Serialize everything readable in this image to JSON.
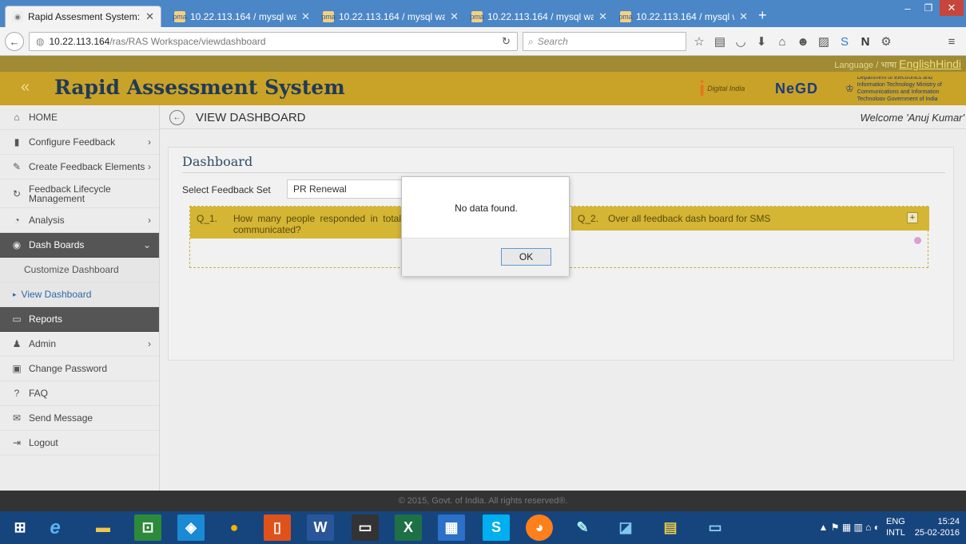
{
  "browser": {
    "tabs": [
      {
        "title": "Rapid Assesment System: ...",
        "active": true
      },
      {
        "title": "10.22.113.164 / mysql wa...",
        "active": false
      },
      {
        "title": "10.22.113.164 / mysql wa...",
        "active": false
      },
      {
        "title": "10.22.113.164 / mysql wa...",
        "active": false
      },
      {
        "title": "10.22.113.164 / mysql wa...",
        "active": false
      }
    ],
    "url_host": "10.22.113.164",
    "url_path": "/ras/RAS Workspace/viewdashboard",
    "search_placeholder": "Search"
  },
  "header": {
    "language_label": "Language / भाषा",
    "lang_english": "English",
    "lang_hindi": "Hindi",
    "app_title": "Rapid Assessment System",
    "logo_digital_india": "Digital India",
    "logo_negd": "NeGD",
    "logo_deity": "Department of Electronics and Information Technology Ministry of Communications and Information Technology Government of India"
  },
  "sidebar": {
    "items": [
      {
        "label": "HOME",
        "icon": "home-icon"
      },
      {
        "label": "Configure Feedback",
        "icon": "file-icon"
      },
      {
        "label": "Create Feedback Elements",
        "icon": "pencil-icon"
      },
      {
        "label": "Feedback Lifecycle Management",
        "icon": "refresh-icon"
      },
      {
        "label": "Analysis",
        "icon": "pie-icon"
      },
      {
        "label": "Dash Boards",
        "icon": "dashboard-icon"
      },
      {
        "label": "Customize Dashboard",
        "icon": ""
      },
      {
        "label": "View Dashboard",
        "icon": "caret-right-icon"
      },
      {
        "label": "Reports",
        "icon": "report-icon"
      },
      {
        "label": "Admin",
        "icon": "user-icon"
      },
      {
        "label": "Change Password",
        "icon": "lock-icon"
      },
      {
        "label": "FAQ",
        "icon": "question-icon"
      },
      {
        "label": "Send Message",
        "icon": "envelope-icon"
      },
      {
        "label": "Logout",
        "icon": "logout-icon"
      }
    ]
  },
  "main": {
    "page_title": "VIEW DASHBOARD",
    "welcome": "Welcome 'Anuj Kumar'",
    "dashboard_title": "Dashboard",
    "select_label": "Select Feedback Set",
    "select_value": "PR Renewal",
    "q1_num": "Q_1.",
    "q1_text": "How many people responded in total communicated?",
    "q2_num": "Q_2.",
    "q2_text": "Over all feedback dash board for SMS"
  },
  "dialog": {
    "message": "No data found.",
    "ok_label": "OK"
  },
  "footer": {
    "copyright": "© 2015, Govt. of India. All rights reserved®."
  },
  "taskbar": {
    "lang_top": "ENG",
    "lang_bottom": "INTL",
    "time": "15:24",
    "date": "25-02-2016"
  }
}
